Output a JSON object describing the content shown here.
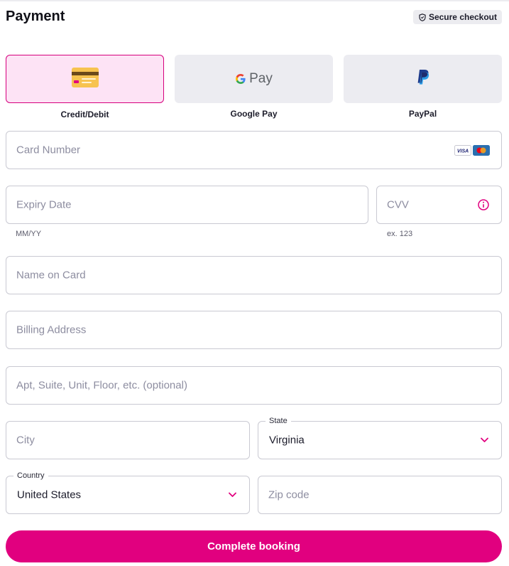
{
  "header": {
    "title": "Payment",
    "secure_label": "Secure checkout"
  },
  "payment_methods": [
    {
      "label": "Credit/Debit",
      "selected": true,
      "icon": "credit-card-icon"
    },
    {
      "label": "Google Pay",
      "selected": false,
      "icon": "google-pay-logo",
      "logo_text": "G Pay"
    },
    {
      "label": "PayPal",
      "selected": false,
      "icon": "paypal-logo"
    }
  ],
  "card_number": {
    "placeholder": "Card Number",
    "brand_logos": [
      "VISA",
      "mastercard"
    ]
  },
  "expiry": {
    "placeholder": "Expiry Date",
    "hint": "MM/YY"
  },
  "cvv": {
    "placeholder": "CVV",
    "hint": "ex. 123",
    "icon": "info-icon"
  },
  "name_on_card": {
    "placeholder": "Name on Card"
  },
  "billing_address": {
    "placeholder": "Billing Address"
  },
  "apt": {
    "placeholder": "Apt, Suite, Unit, Floor, etc. (optional)"
  },
  "city": {
    "placeholder": "City"
  },
  "state": {
    "label": "State",
    "value": "Virginia"
  },
  "country": {
    "label": "Country",
    "value": "United States"
  },
  "zip": {
    "placeholder": "Zip code"
  },
  "submit": {
    "label": "Complete booking"
  },
  "colors": {
    "accent": "#e1007f",
    "selected_bg": "#fde3f5",
    "tile_bg": "#ececf1",
    "border": "#c9c9d2",
    "placeholder": "#8d8da0"
  }
}
